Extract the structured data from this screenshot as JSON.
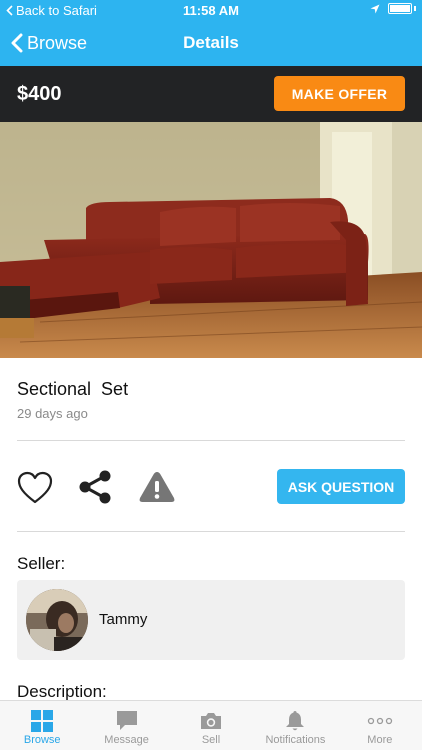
{
  "status_bar": {
    "back_app": "Back to Safari",
    "time": "11:58 AM"
  },
  "nav": {
    "back_label": "Browse",
    "title": "Details"
  },
  "listing": {
    "price": "$400",
    "make_offer_label": "MAKE OFFER",
    "title": "Sectional  Set",
    "age": "29 days ago",
    "photo": "red-leather-sectional-sofa-photo"
  },
  "actions": {
    "favorite_icon": "heart-outline-icon",
    "share_icon": "share-icon",
    "report_icon": "warning-triangle-icon",
    "ask_question_label": "ASK QUESTION"
  },
  "seller": {
    "label": "Seller:",
    "name": "Tammy"
  },
  "description": {
    "label": "Description:"
  },
  "tabs": [
    {
      "label": "Browse",
      "icon": "grid-icon",
      "active": true
    },
    {
      "label": "Message",
      "icon": "chat-bubble-icon",
      "active": false
    },
    {
      "label": "Sell",
      "icon": "camera-icon",
      "active": false
    },
    {
      "label": "Notifications",
      "icon": "bell-icon",
      "active": false
    },
    {
      "label": "More",
      "icon": "more-dots-icon",
      "active": false
    }
  ],
  "colors": {
    "brand_blue": "#2db4f0",
    "offer_orange": "#f98a14",
    "price_bar": "#222325",
    "tab_active": "#2aa7e8"
  }
}
